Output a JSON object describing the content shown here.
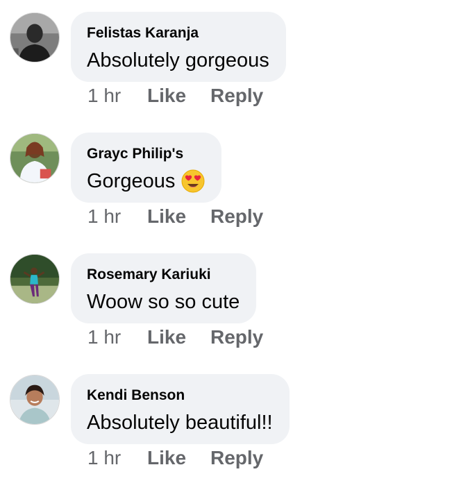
{
  "comments": [
    {
      "author": "Felistas Karanja",
      "text": "Absolutely gorgeous",
      "emoji": "",
      "time": "1 hr",
      "like_label": "Like",
      "reply_label": "Reply",
      "avatar_icon": "profile-photo-man-in-black"
    },
    {
      "author": "Grayc Philip's",
      "text": "Gorgeous",
      "emoji": "heart-eyes-emoji",
      "time": "1 hr",
      "like_label": "Like",
      "reply_label": "Reply",
      "avatar_icon": "profile-photo-woman-in-white"
    },
    {
      "author": "Rosemary Kariuki",
      "text": "Woow so so cute",
      "emoji": "",
      "time": "1 hr",
      "like_label": "Like",
      "reply_label": "Reply",
      "avatar_icon": "profile-photo-woman-on-grass"
    },
    {
      "author": "Kendi Benson",
      "text": "Absolutely beautiful!!",
      "emoji": "",
      "time": "1 hr",
      "like_label": "Like",
      "reply_label": "Reply",
      "avatar_icon": "profile-photo-smiling-girl"
    }
  ],
  "colors": {
    "bubble_background": "#f0f2f5",
    "author_text": "#050505",
    "action_text": "#65676b"
  }
}
